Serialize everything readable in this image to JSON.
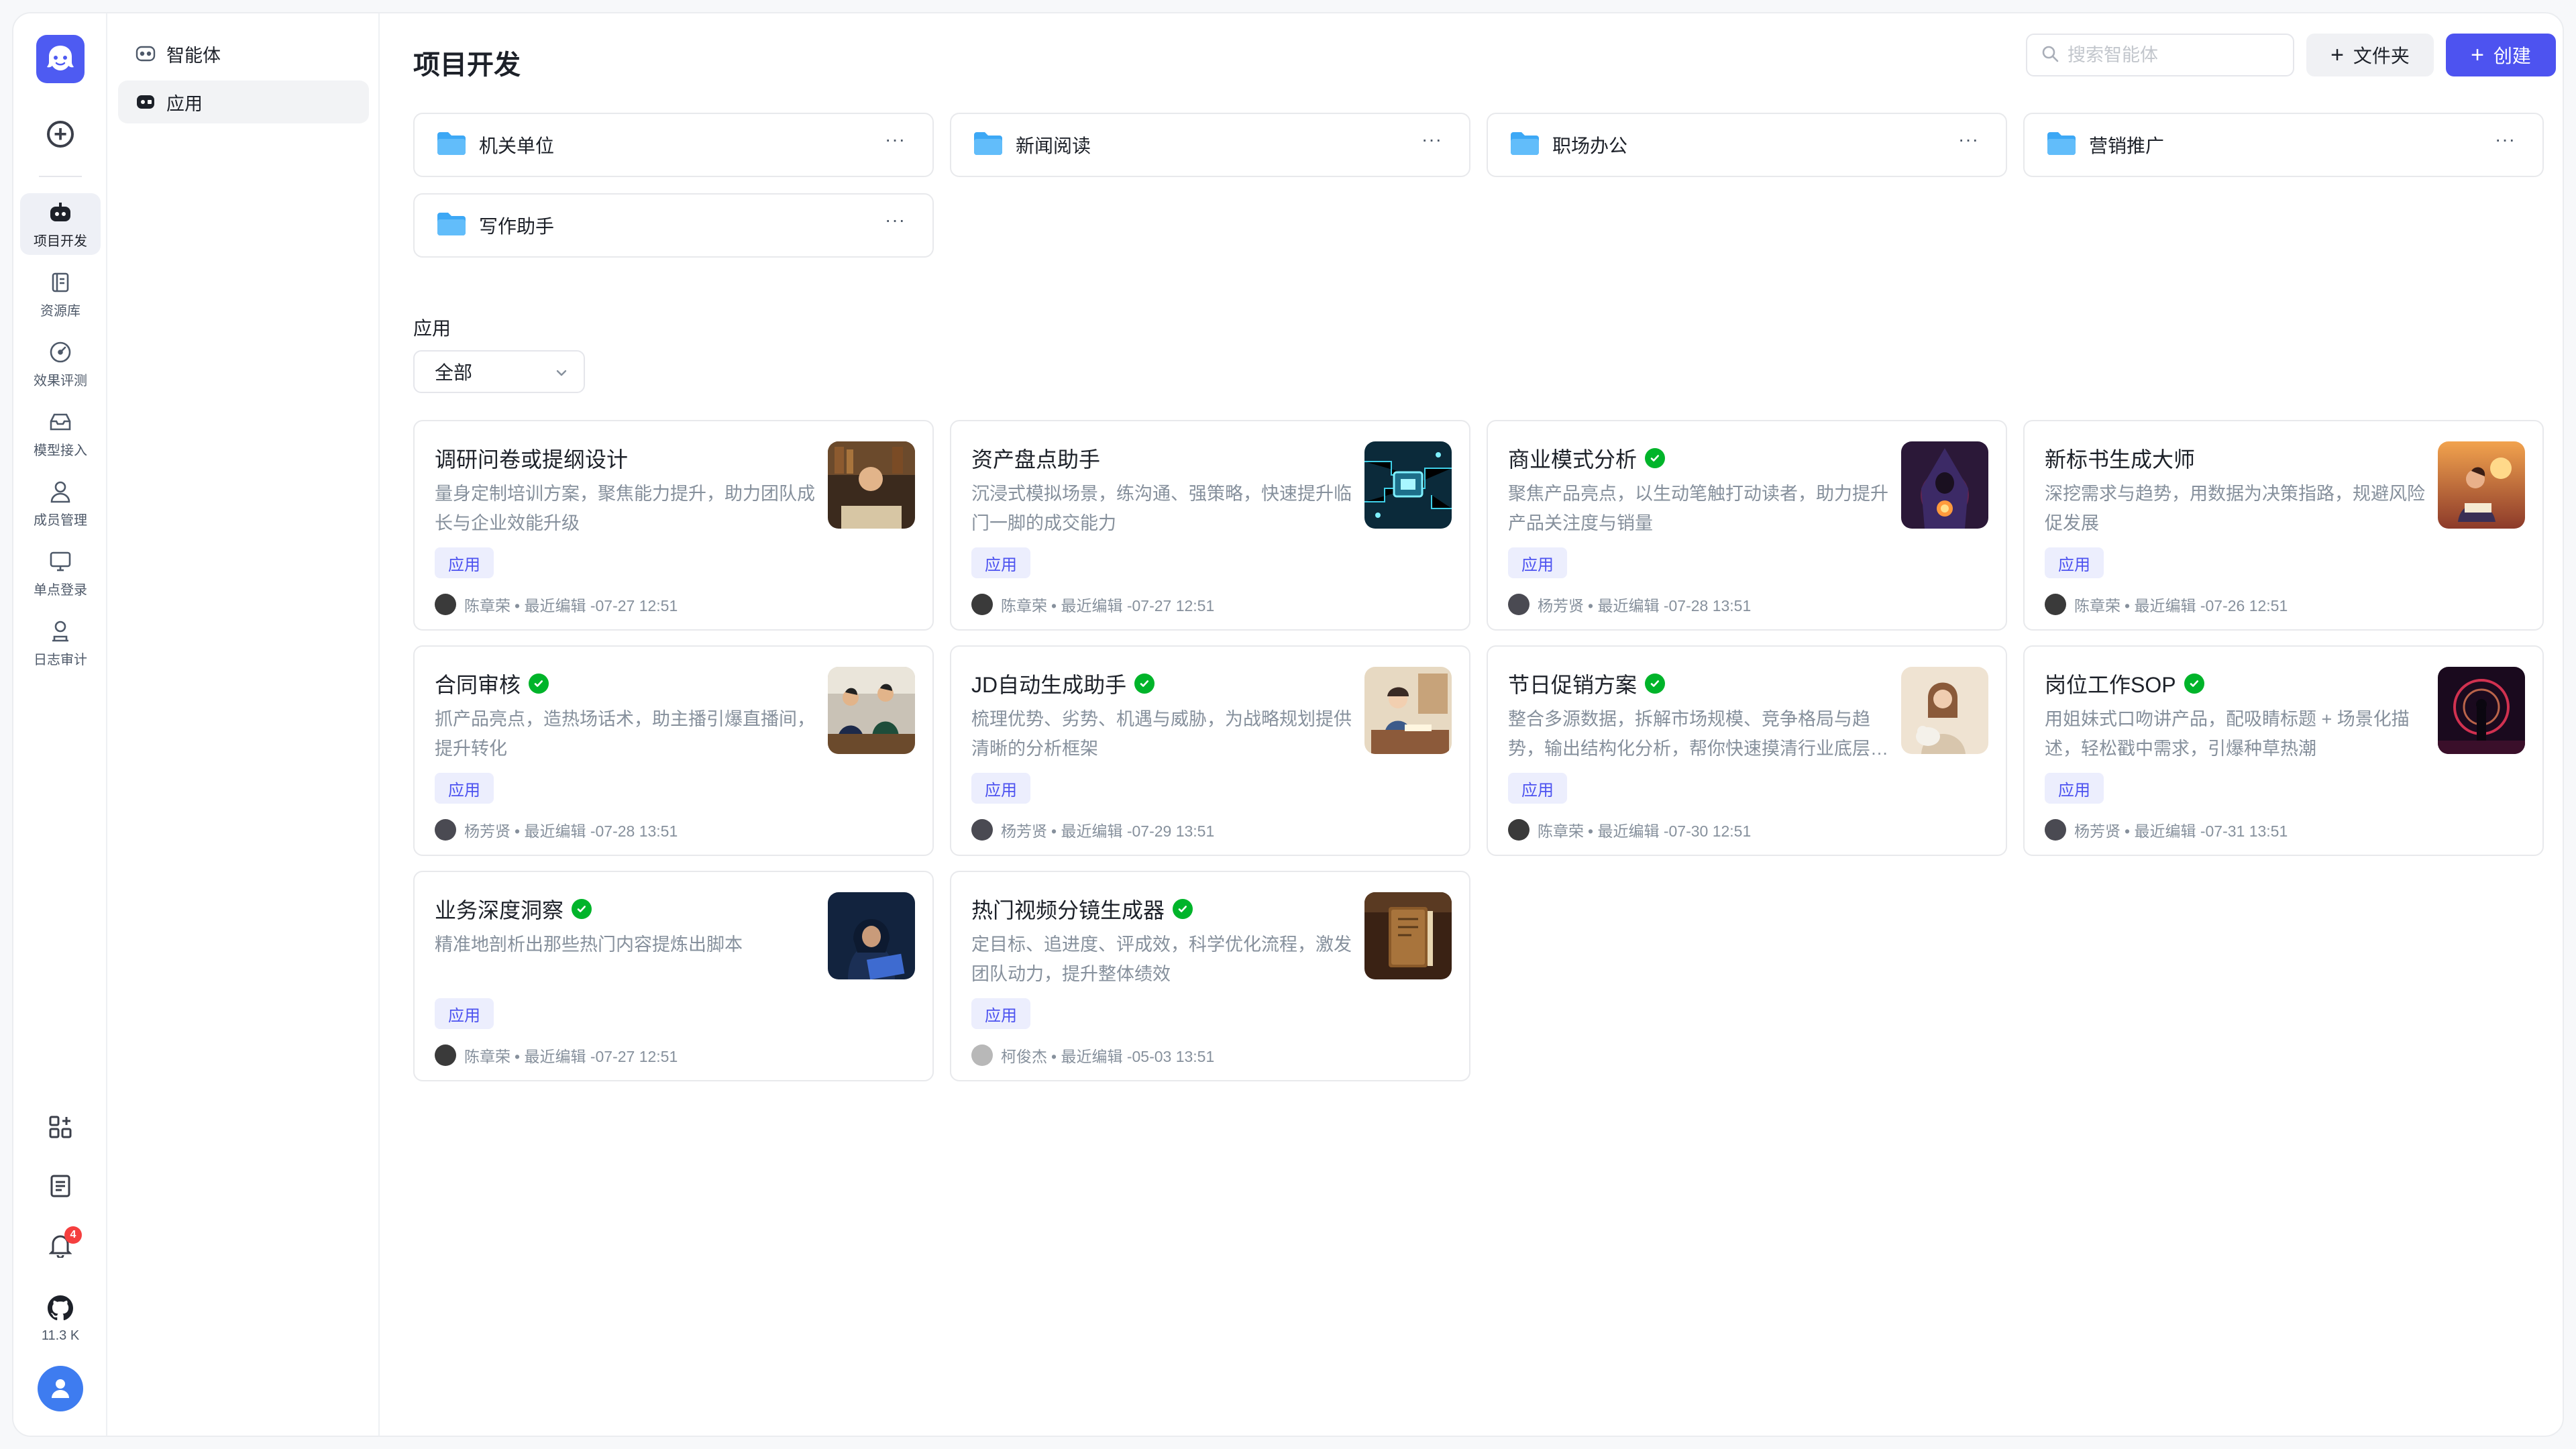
{
  "rail": {
    "nav": [
      {
        "label": "项目开发",
        "icon": "robot-icon",
        "active": true
      },
      {
        "label": "资源库",
        "icon": "library-icon",
        "active": false
      },
      {
        "label": "效果评测",
        "icon": "gauge-icon",
        "active": false
      },
      {
        "label": "模型接入",
        "icon": "inbox-icon",
        "active": false
      },
      {
        "label": "成员管理",
        "icon": "user-icon",
        "active": false
      },
      {
        "label": "单点登录",
        "icon": "monitor-icon",
        "active": false
      },
      {
        "label": "日志审计",
        "icon": "audit-icon",
        "active": false
      }
    ],
    "notification_count": "4",
    "github_stars": "11.3 K"
  },
  "subnav": {
    "items": [
      {
        "label": "智能体",
        "icon": "agent-icon",
        "active": false
      },
      {
        "label": "应用",
        "icon": "app-icon",
        "active": true
      }
    ]
  },
  "header": {
    "title": "项目开发",
    "search_placeholder": "搜索智能体",
    "folder_button": "文件夹",
    "create_button": "创建"
  },
  "folders": [
    {
      "name": "机关单位",
      "more": "···"
    },
    {
      "name": "新闻阅读",
      "more": "···"
    },
    {
      "name": "职场办公",
      "more": "···"
    },
    {
      "name": "营销推广",
      "more": "···"
    },
    {
      "name": "写作助手",
      "more": "···"
    }
  ],
  "apps_section": {
    "label": "应用",
    "filter_value": "全部"
  },
  "apps": [
    {
      "title": "调研问卷或提纲设计",
      "verified": false,
      "desc": "量身定制培训方案，聚焦能力提升，助力团队成长与企业效能升级",
      "tag": "应用",
      "author": "陈章荣",
      "edited": "• 最近编辑 -07-27 12:51",
      "thumb": "study-scene"
    },
    {
      "title": "资产盘点助手",
      "verified": false,
      "desc": "沉浸式模拟场景，练沟通、强策略，快速提升临门一脚的成交能力",
      "tag": "应用",
      "author": "陈章荣",
      "edited": "• 最近编辑 -07-27 12:51",
      "thumb": "circuit-scene"
    },
    {
      "title": "商业模式分析",
      "verified": true,
      "desc": "聚焦产品亮点，以生动笔触打动读者，助力提升产品关注度与销量",
      "tag": "应用",
      "author": "杨芳贤",
      "edited": "• 最近编辑 -07-28 13:51",
      "thumb": "wizard-scene"
    },
    {
      "title": "新标书生成大师",
      "verified": false,
      "desc": "深挖需求与趋势，用数据为决策指路，规避风险促发展",
      "tag": "应用",
      "author": "陈章荣",
      "edited": "• 最近编辑 -07-26 12:51",
      "thumb": "sunset-reader-scene"
    },
    {
      "title": "合同审核",
      "verified": true,
      "desc": "抓产品亮点，造热场话术，助主播引爆直播间，提升转化",
      "tag": "应用",
      "author": "杨芳贤",
      "edited": "• 最近编辑 -07-28 13:51",
      "thumb": "classroom-scene"
    },
    {
      "title": "JD自动生成助手",
      "verified": true,
      "desc": "梳理优势、劣势、机遇与威胁，为战略规划提供清晰的分析框架",
      "tag": "应用",
      "author": "杨芳贤",
      "edited": "• 最近编辑 -07-29 13:51",
      "thumb": "anime-study-scene"
    },
    {
      "title": "节日促销方案",
      "verified": true,
      "desc": "整合多源数据，拆解市场规模、竞争格局与趋势，输出结构化分析，帮你快速摸清行业底层逻辑",
      "tag": "应用",
      "author": "陈章荣",
      "edited": "• 最近编辑 -07-30 12:51",
      "thumb": "girl-cat-scene"
    },
    {
      "title": "岗位工作SOP",
      "verified": true,
      "desc": "用姐妹式口吻讲产品，配吸睛标题 + 场景化描述，轻松戳中需求，引爆种草热潮",
      "tag": "应用",
      "author": "杨芳贤",
      "edited": "• 最近编辑 -07-31 13:51",
      "thumb": "neon-scene"
    },
    {
      "title": "业务深度洞察",
      "verified": true,
      "desc": "精准地剖析出那些热门内容提炼出脚本",
      "tag": "应用",
      "author": "陈章荣",
      "edited": "• 最近编辑 -07-27 12:51",
      "thumb": "hacker-scene"
    },
    {
      "title": "热门视频分镜生成器",
      "verified": true,
      "desc": "定目标、追进度、评成效，科学优化流程，激发团队动力，提升整体绩效",
      "tag": "应用",
      "author": "柯俊杰",
      "edited": "• 最近编辑 -05-03 13:51",
      "thumb": "book-scene"
    }
  ],
  "colors": {
    "accent": "#4d53f0",
    "verified": "#00b42a",
    "folder": "#3da8f5",
    "badge": "#f53f3f"
  }
}
